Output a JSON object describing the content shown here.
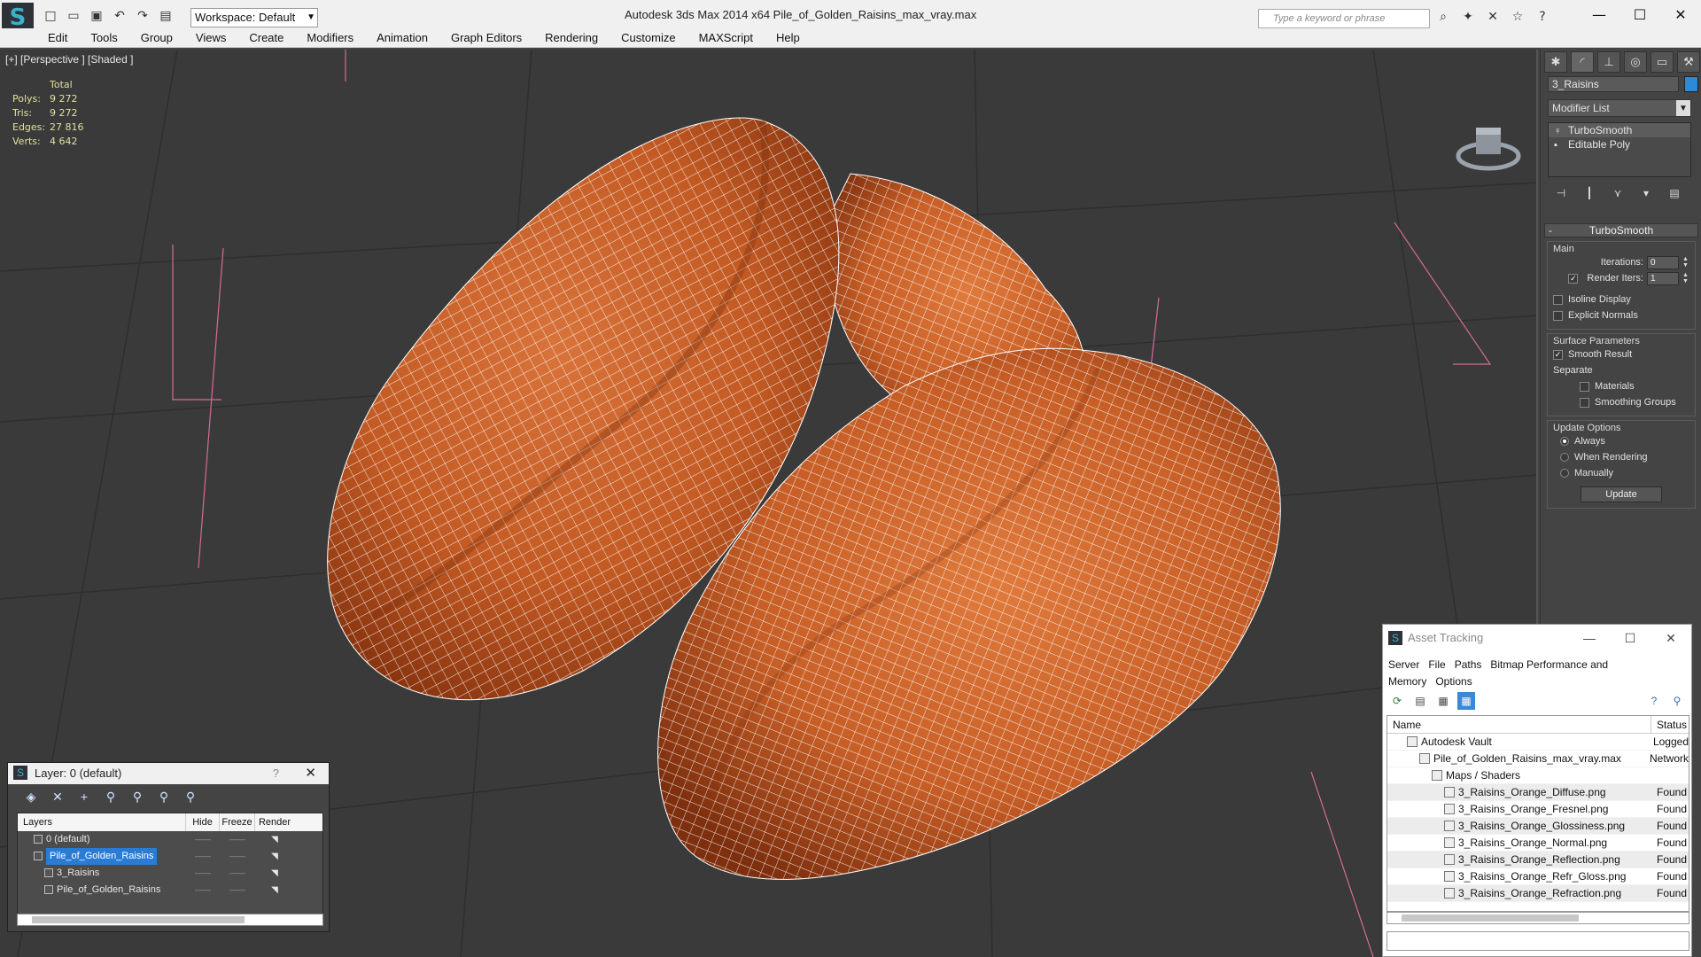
{
  "app": {
    "title": "Autodesk 3ds Max  2014 x64     Pile_of_Golden_Raisins_max_vray.max",
    "logo_glyph": "S",
    "workspace_label": "Workspace: Default",
    "search_placeholder": "Type a keyword or phrase"
  },
  "menu": [
    "Edit",
    "Tools",
    "Group",
    "Views",
    "Create",
    "Modifiers",
    "Animation",
    "Graph Editors",
    "Rendering",
    "Customize",
    "MAXScript",
    "Help"
  ],
  "viewport": {
    "label": "[+] [Perspective ] [Shaded ]",
    "stats_header": "Total",
    "stats": [
      {
        "k": "Polys:",
        "v": "9 272"
      },
      {
        "k": "Tris:",
        "v": "9 272"
      },
      {
        "k": "Edges:",
        "v": "27 816"
      },
      {
        "k": "Verts:",
        "v": "4 642"
      }
    ],
    "mesh_color": "#c35a23",
    "wire_color": "#ffffff",
    "bbox_color": "#d66a9a"
  },
  "command_panel": {
    "object_name": "3_Raisins",
    "object_color": "#2c8ad6",
    "modifier_list": "Modifier List",
    "stack": [
      "TurboSmooth",
      "Editable Poly"
    ],
    "rollout_title": "TurboSmooth",
    "main_label": "Main",
    "iterations_label": "Iterations:",
    "iterations_value": "0",
    "render_iters_label": "Render Iters:",
    "render_iters_value": "1",
    "isoline_label": "Isoline Display",
    "explicit_normals_label": "Explicit Normals",
    "surface_params_label": "Surface Parameters",
    "smooth_result_label": "Smooth Result",
    "separate_label": "Separate",
    "materials_label": "Materials",
    "smoothing_groups_label": "Smoothing Groups",
    "update_options_label": "Update Options",
    "always_label": "Always",
    "when_rendering_label": "When Rendering",
    "manually_label": "Manually",
    "update_button": "Update"
  },
  "layer_dialog": {
    "title": "Layer: 0 (default)",
    "help": "?",
    "columns": [
      "Layers",
      "Hide",
      "Freeze",
      "Render"
    ],
    "rows": [
      {
        "name": "0 (default)",
        "indent": 1
      },
      {
        "name": "Pile_of_Golden_Raisins",
        "indent": 1,
        "selected": true
      },
      {
        "name": "3_Raisins",
        "indent": 2
      },
      {
        "name": "Pile_of_Golden_Raisins",
        "indent": 2
      }
    ]
  },
  "asset_tracking": {
    "title": "Asset Tracking",
    "menu": [
      "Server",
      "File",
      "Paths",
      "Bitmap Performance and Memory",
      "Options"
    ],
    "columns": [
      "Name",
      "Status"
    ],
    "rows": [
      {
        "name": "Autodesk Vault",
        "status": "Logged",
        "indent": 1
      },
      {
        "name": "Pile_of_Golden_Raisins_max_vray.max",
        "status": "Network",
        "indent": 2
      },
      {
        "name": "Maps / Shaders",
        "status": "",
        "indent": 3
      },
      {
        "name": "3_Raisins_Orange_Diffuse.png",
        "status": "Found",
        "indent": 4
      },
      {
        "name": "3_Raisins_Orange_Fresnel.png",
        "status": "Found",
        "indent": 4
      },
      {
        "name": "3_Raisins_Orange_Glossiness.png",
        "status": "Found",
        "indent": 4
      },
      {
        "name": "3_Raisins_Orange_Normal.png",
        "status": "Found",
        "indent": 4
      },
      {
        "name": "3_Raisins_Orange_Reflection.png",
        "status": "Found",
        "indent": 4
      },
      {
        "name": "3_Raisins_Orange_Refr_Gloss.png",
        "status": "Found",
        "indent": 4
      },
      {
        "name": "3_Raisins_Orange_Refraction.png",
        "status": "Found",
        "indent": 4
      }
    ]
  }
}
